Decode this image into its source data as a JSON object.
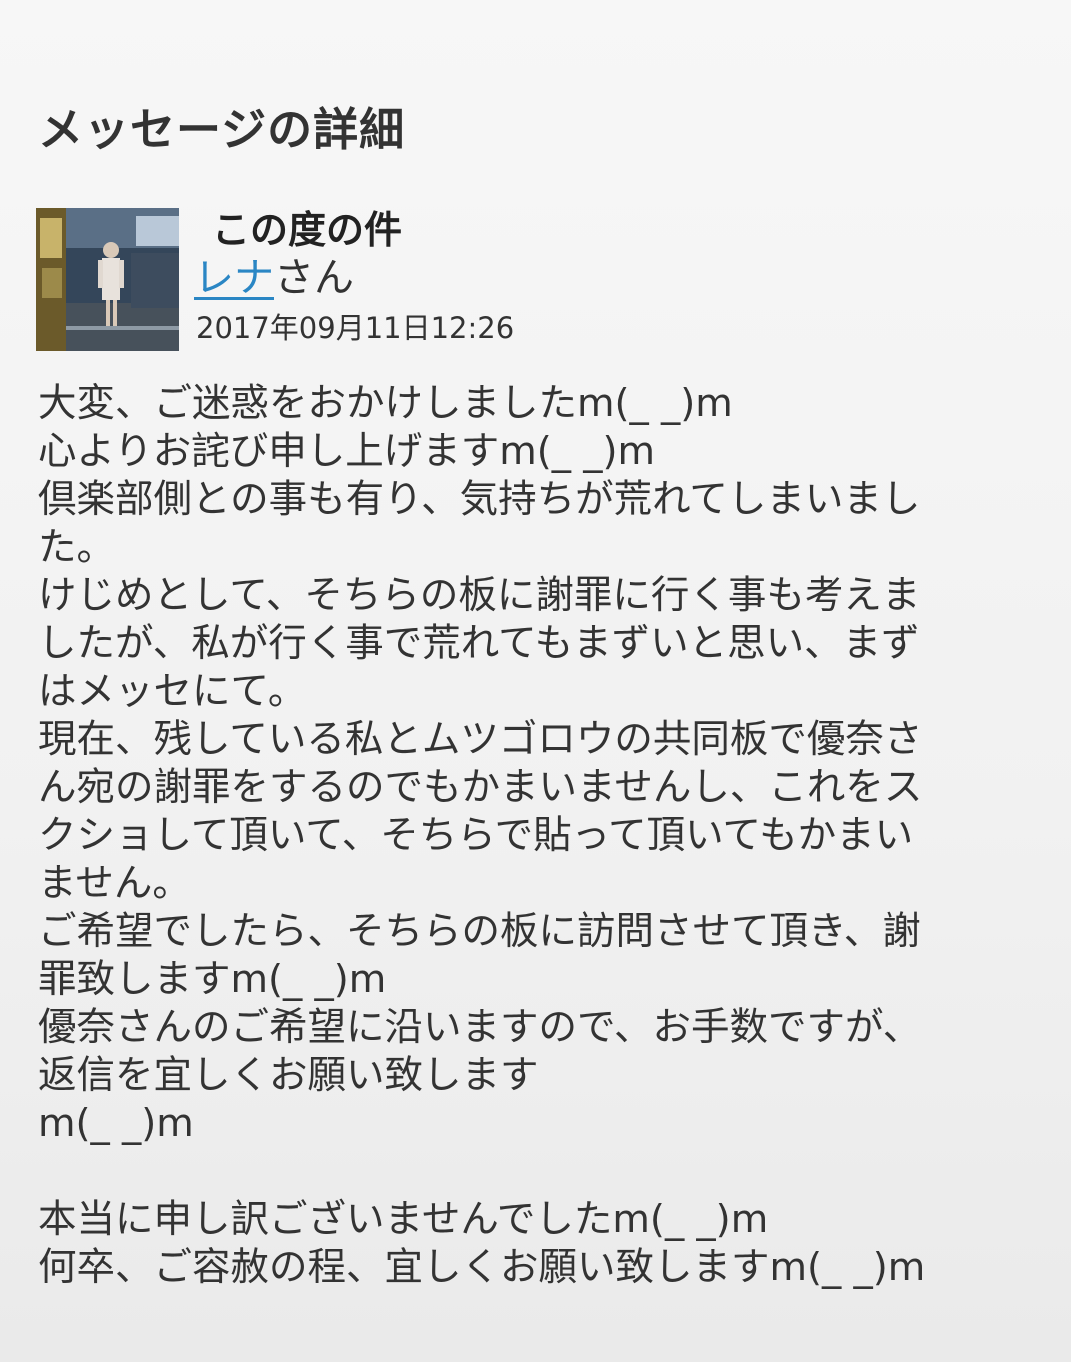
{
  "page": {
    "title": "メッセージの詳細"
  },
  "message": {
    "subject": "この度の件",
    "sender_name": "レナ",
    "sender_suffix": "さん",
    "timestamp": "2017年09月11日12:26",
    "avatar_icon": "user-photo-avatar",
    "colors": {
      "link": "#2a86c4",
      "text": "#333333",
      "background": "#f3f3f3"
    },
    "body_lines": [
      "大変、ご迷惑をおかけしましたm(_ _)m",
      "心よりお詫び申し上げますm(_ _)m",
      "倶楽部側との事も有り、気持ちが荒れてしまいまし",
      "た。",
      "けじめとして、そちらの板に謝罪に行く事も考えま",
      "したが、私が行く事で荒れてもまずいと思い、まず",
      "はメッセにて。",
      "現在、残している私とムツゴロウの共同板で優奈さ",
      "ん宛の謝罪をするのでもかまいませんし、これをス",
      "クショして頂いて、そちらで貼って頂いてもかまい",
      "ません。",
      "ご希望でしたら、そちらの板に訪問させて頂き、謝",
      "罪致しますm(_ _)m",
      "優奈さんのご希望に沿いますので、お手数ですが、",
      "返信を宜しくお願い致します",
      "m(_ _)m",
      "",
      "本当に申し訳ございませんでしたm(_ _)m",
      "何卒、ご容赦の程、宜しくお願い致しますm(_ _)m"
    ]
  }
}
